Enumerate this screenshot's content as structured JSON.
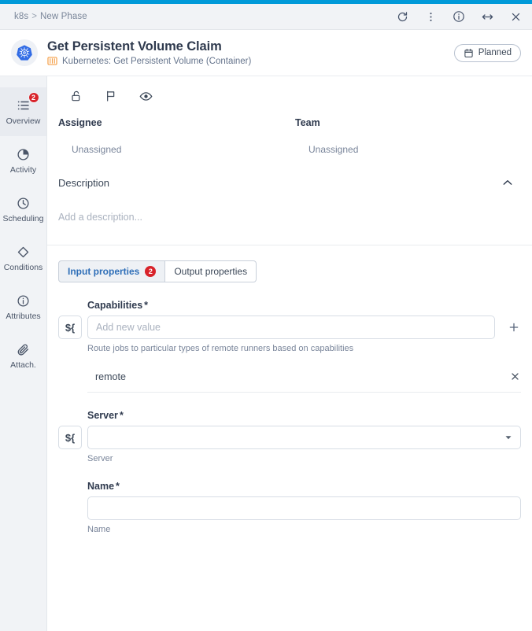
{
  "titlebar": {
    "breadcrumb_root": "k8s",
    "breadcrumb_sep": ">",
    "breadcrumb_current": "New Phase",
    "actions": [
      {
        "name": "refresh-icon",
        "label": "Refresh"
      },
      {
        "name": "more-vertical-icon",
        "label": "More options"
      },
      {
        "name": "info-icon",
        "label": "Info"
      },
      {
        "name": "resize-horizontal-icon",
        "label": "Resize"
      },
      {
        "name": "close-icon",
        "label": "Close"
      }
    ]
  },
  "header": {
    "logo": "kubernetes-logo",
    "title": "Get Persistent Volume Claim",
    "subtitle": "Kubernetes: Get Persistent Volume (Container)",
    "subtitle_icon": "container-icon",
    "status": "Planned",
    "status_icon": "calendar-icon"
  },
  "sidebar": {
    "items": [
      {
        "label": "Overview",
        "icon": "list-icon",
        "badge": "2",
        "active": true
      },
      {
        "label": "Activity",
        "icon": "pie-chart-icon",
        "badge": "",
        "active": false
      },
      {
        "label": "Scheduling",
        "icon": "clock-icon",
        "badge": "",
        "active": false
      },
      {
        "label": "Conditions",
        "icon": "diamond-icon",
        "badge": "",
        "active": false
      },
      {
        "label": "Attributes",
        "icon": "info-icon",
        "badge": "",
        "active": false
      },
      {
        "label": "Attach.",
        "icon": "paperclip-icon",
        "badge": "",
        "active": false
      }
    ]
  },
  "toolbar": {
    "icons": [
      {
        "name": "unlock-icon",
        "label": "Unlock"
      },
      {
        "name": "flag-icon",
        "label": "Flag"
      },
      {
        "name": "eye-icon",
        "label": "Watch"
      }
    ]
  },
  "meta": {
    "assignee_label": "Assignee",
    "assignee_value": "Unassigned",
    "team_label": "Team",
    "team_value": "Unassigned"
  },
  "description": {
    "title": "Description",
    "placeholder": "Add a description...",
    "collapse_icon": "chevron-up-icon"
  },
  "tabs": [
    {
      "label": "Input properties",
      "badge": "2",
      "active": true
    },
    {
      "label": "Output properties",
      "badge": "",
      "active": false
    }
  ],
  "fields": {
    "capabilities": {
      "label": "Capabilities",
      "required": "*",
      "expr_button": "${",
      "placeholder": "Add new value",
      "value": "",
      "help": "Route jobs to particular types of remote runners based on capabilities",
      "add_icon": "plus-icon",
      "items": [
        {
          "value": "remote",
          "remove_icon": "close-icon"
        }
      ]
    },
    "server": {
      "label": "Server",
      "required": "*",
      "expr_button": "${",
      "value": "",
      "placeholder": "",
      "help": "Server",
      "caret_icon": "chevron-down-icon"
    },
    "name": {
      "label": "Name",
      "required": "*",
      "value": "",
      "placeholder": "",
      "help": "Name"
    }
  },
  "colors": {
    "accent": "#009ad9",
    "badge_red": "#d8232a",
    "tab_active_text": "#2f6fb8",
    "kubernetes_blue": "#326ce5",
    "container_orange": "#f5a04a"
  }
}
